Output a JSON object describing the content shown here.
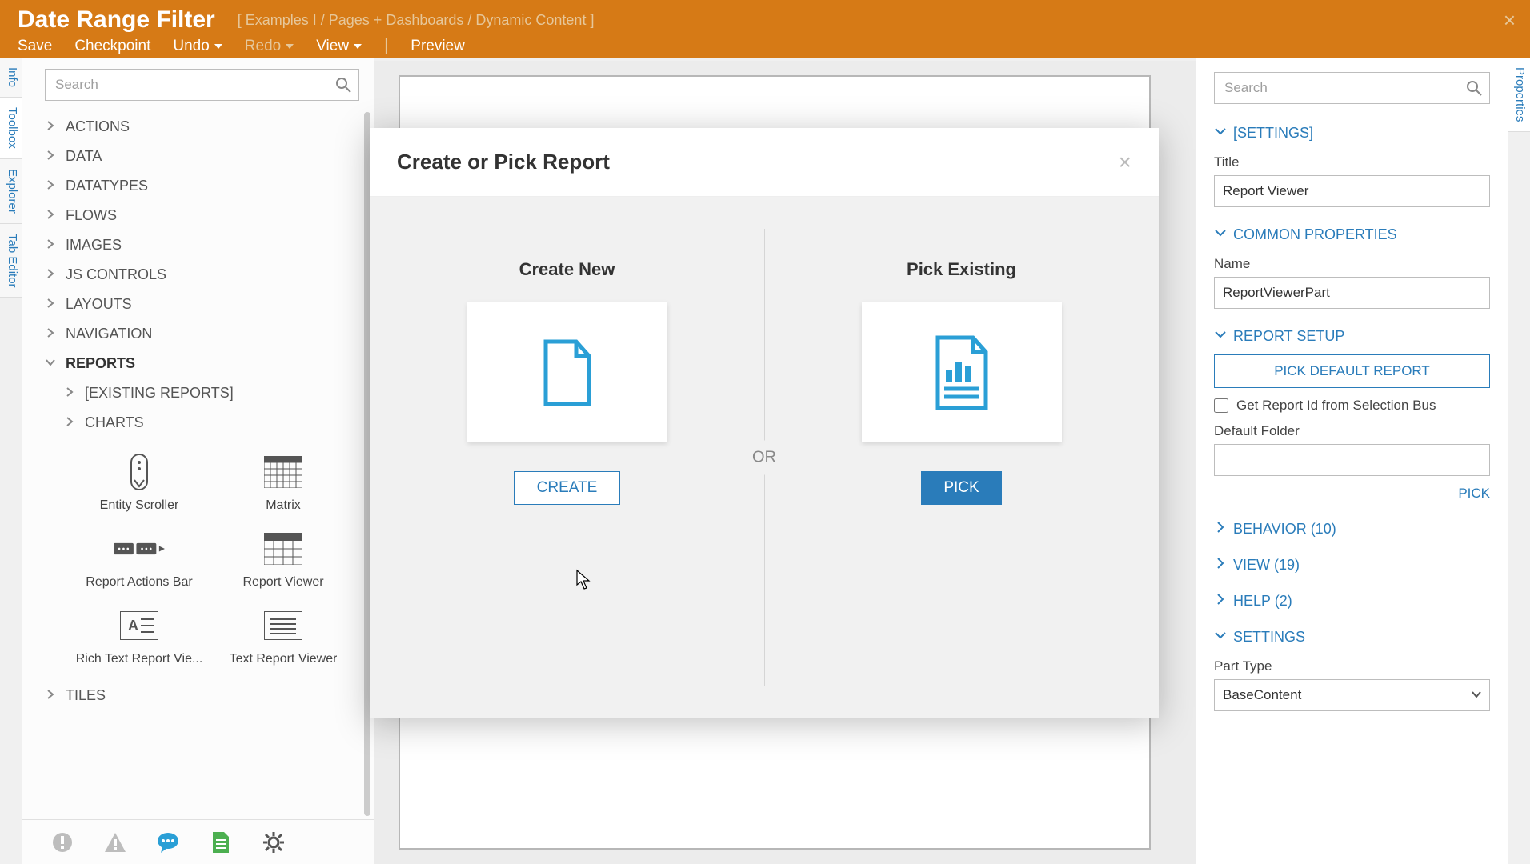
{
  "header": {
    "title": "Date Range Filter",
    "breadcrumb": "[ Examples I / Pages + Dashboards / Dynamic Content ]"
  },
  "toolbar": {
    "save": "Save",
    "checkpoint": "Checkpoint",
    "undo": "Undo",
    "redo": "Redo",
    "view": "View",
    "preview": "Preview"
  },
  "side_tabs_left": [
    "Info",
    "Toolbox",
    "Explorer",
    "Tab Editor"
  ],
  "side_tabs_right": [
    "Properties"
  ],
  "left_panel": {
    "search_placeholder": "Search",
    "categories": [
      {
        "label": "ACTIONS",
        "expanded": false
      },
      {
        "label": "DATA",
        "expanded": false
      },
      {
        "label": "DATATYPES",
        "expanded": false
      },
      {
        "label": "FLOWS",
        "expanded": false
      },
      {
        "label": "IMAGES",
        "expanded": false
      },
      {
        "label": "JS CONTROLS",
        "expanded": false
      },
      {
        "label": "LAYOUTS",
        "expanded": false
      },
      {
        "label": "NAVIGATION",
        "expanded": false
      },
      {
        "label": "REPORTS",
        "expanded": true
      },
      {
        "label": "TILES",
        "expanded": false
      }
    ],
    "reports_children": [
      "[EXISTING REPORTS]",
      "CHARTS"
    ],
    "report_tools": [
      "Entity Scroller",
      "Matrix",
      "Report Actions Bar",
      "Report Viewer",
      "Rich Text Report Vie...",
      "Text Report Viewer"
    ]
  },
  "modal": {
    "title": "Create or Pick Report",
    "create_title": "Create New",
    "create_btn": "CREATE",
    "or": "OR",
    "pick_title": "Pick Existing",
    "pick_btn": "PICK"
  },
  "right_panel": {
    "search_placeholder": "Search",
    "sections": {
      "settings_brackets": "[SETTINGS]",
      "common": "COMMON PROPERTIES",
      "report_setup": "REPORT SETUP",
      "behavior": "BEHAVIOR (10)",
      "view": "VIEW (19)",
      "help": "HELP (2)",
      "settings": "SETTINGS"
    },
    "title_label": "Title",
    "title_value": "Report Viewer",
    "name_label": "Name",
    "name_value": "ReportViewerPart",
    "pick_default_btn": "PICK DEFAULT REPORT",
    "get_report_id_label": "Get Report Id from Selection Bus",
    "default_folder_label": "Default Folder",
    "default_folder_value": "",
    "pick_link": "PICK",
    "part_type_label": "Part Type",
    "part_type_value": "BaseContent"
  }
}
